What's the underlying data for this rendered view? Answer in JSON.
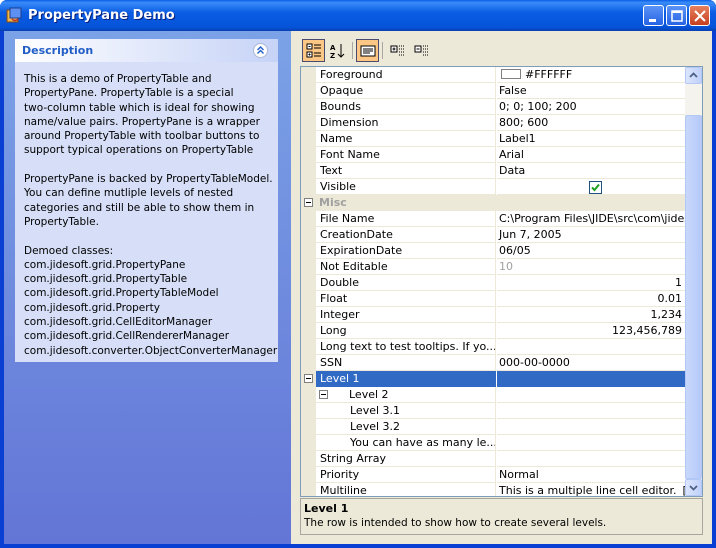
{
  "window": {
    "title": "PropertyPane Demo",
    "buttons": [
      "minimize",
      "maximize",
      "close"
    ]
  },
  "description_panel": {
    "title": "Description",
    "lines": [
      "This is a demo of PropertyTable and",
      "PropertyPane. PropertyTable is a special",
      "two-column table which is ideal for showing",
      "name/value pairs. PropertyPane is a wrapper",
      "around PropertyTable with toolbar buttons to",
      "support typical operations on PropertyTable",
      "",
      "PropertyPane is backed by PropertyTableModel.",
      "You can define mutliple levels of nested",
      "categories and still be able to show them in",
      "PropertyTable.",
      "",
      "Demoed classes:",
      "com.jidesoft.grid.PropertyPane",
      "com.jidesoft.grid.PropertyTable",
      "com.jidesoft.grid.PropertyTableModel",
      "com.jidesoft.grid.Property",
      "com.jidesoft.grid.CellEditorManager",
      "com.jidesoft.grid.CellRendererManager",
      "com.jidesoft.converter.ObjectConverterManager"
    ]
  },
  "toolbar": {
    "buttons": [
      "categorized-view-icon",
      "alphabetical-sort-icon",
      "toggle-description-icon",
      "expand-all-icon",
      "collapse-all-icon"
    ]
  },
  "property_table": {
    "rows": [
      {
        "name": "Foreground",
        "value": "#FFFFFF",
        "kind": "color"
      },
      {
        "name": "Opaque",
        "value": "False"
      },
      {
        "name": "Bounds",
        "value": "0; 0; 100; 200"
      },
      {
        "name": "Dimension",
        "value": "800; 600"
      },
      {
        "name": "Name",
        "value": "Label1"
      },
      {
        "name": "Font Name",
        "value": "Arial"
      },
      {
        "name": "Text",
        "value": "Data"
      },
      {
        "name": "Visible",
        "value": "",
        "kind": "checkbox",
        "checked": true
      },
      {
        "name": "Misc",
        "kind": "category"
      },
      {
        "name": "File Name",
        "value": "C:\\Program Files\\JIDE\\src\\com\\jidesof..."
      },
      {
        "name": "CreationDate",
        "value": "Jun 7, 2005"
      },
      {
        "name": "ExpirationDate",
        "value": "06/05"
      },
      {
        "name": "Not Editable",
        "value": "10",
        "kind": "disabled"
      },
      {
        "name": "Double",
        "value": "1",
        "align": "right"
      },
      {
        "name": "Float",
        "value": "0.01",
        "align": "right"
      },
      {
        "name": "Integer",
        "value": "1,234",
        "align": "right"
      },
      {
        "name": "Long",
        "value": "123,456,789",
        "align": "right"
      },
      {
        "name": "Long text to test tooltips. If yo...",
        "value": ""
      },
      {
        "name": "SSN",
        "value": "000-00-0000"
      },
      {
        "name": "Level 1",
        "value": "",
        "kind": "selected",
        "expander": 0
      },
      {
        "name": "Level 2",
        "value": "",
        "expander": 1,
        "indent": 1
      },
      {
        "name": "Level 3.1",
        "value": "",
        "indent": 2
      },
      {
        "name": "Level 3.2",
        "value": "",
        "indent": 2
      },
      {
        "name": "You can have as many le...",
        "value": "",
        "indent": 2
      },
      {
        "name": "String Array",
        "value": ""
      },
      {
        "name": "Priority",
        "value": "Normal"
      },
      {
        "name": "Multiline",
        "value": "This is a multiple line cell editor.",
        "button": "[...]"
      }
    ]
  },
  "info": {
    "title": "Level 1",
    "text": "The row is intended to show how to create several levels."
  },
  "colors": {
    "titlebar": "#0b5de4",
    "selection": "#316ac5",
    "panel_gradient_top": "#7ba2e7",
    "panel_gradient_bottom": "#6375d6",
    "description_title": "#215dc6"
  }
}
